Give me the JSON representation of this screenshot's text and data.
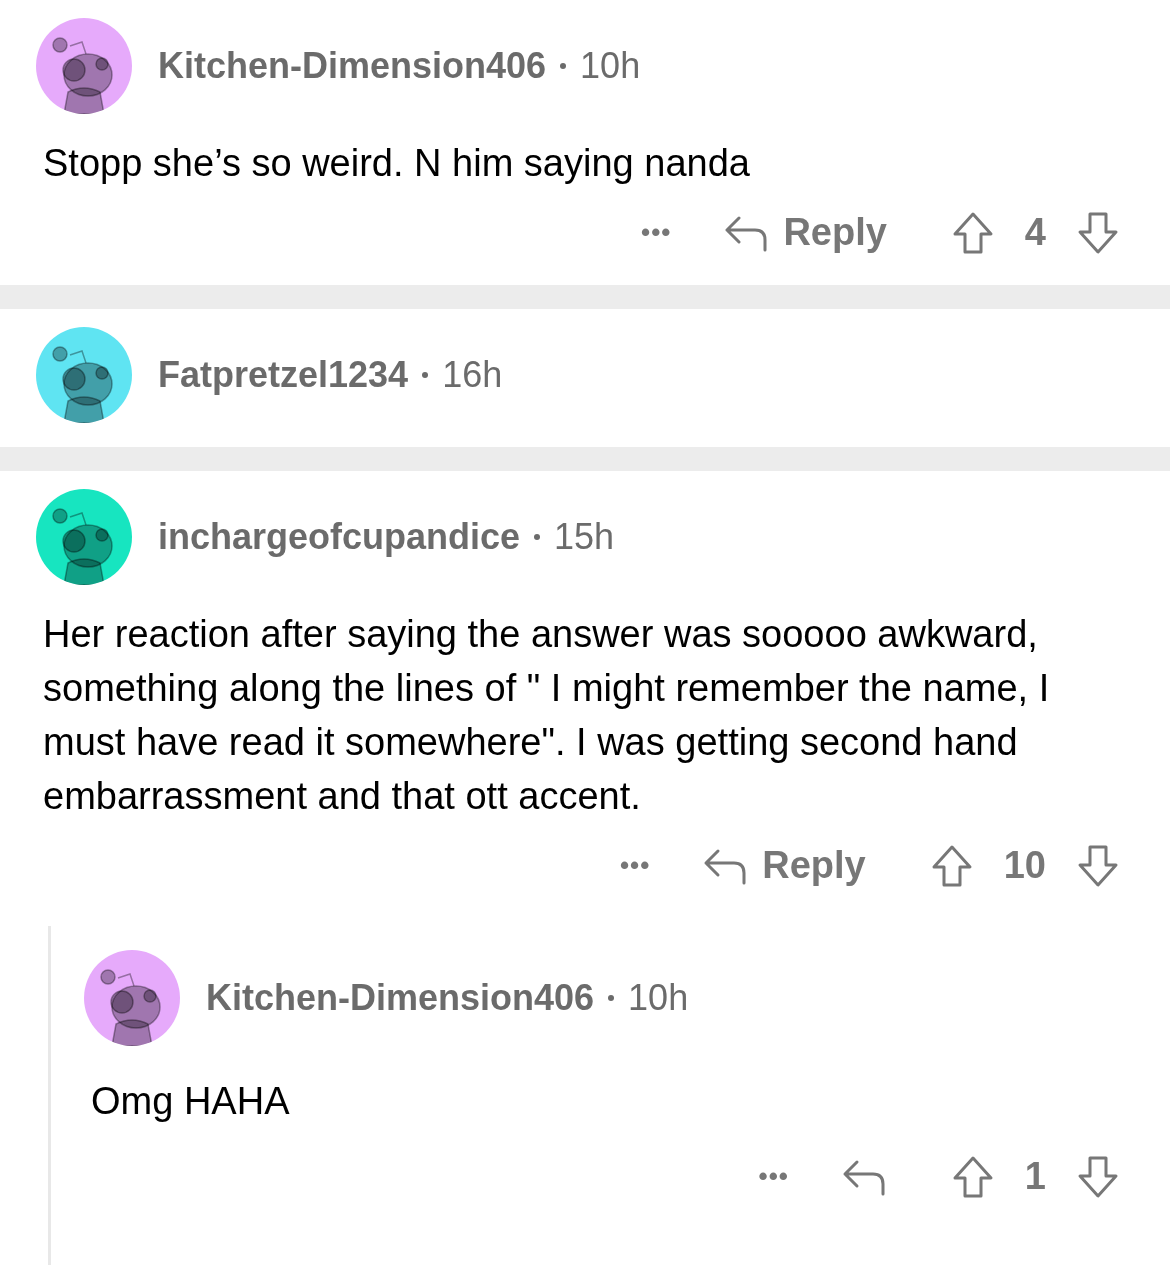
{
  "comments": [
    {
      "author": "Kitchen-Dimension406",
      "time": "10h",
      "color": "#e6aafb",
      "body": "Stopp she’s so weird. N him saying nanda",
      "more": "•••",
      "reply_label": "Reply",
      "score": "4"
    },
    {
      "author": "Fatpretzel1234",
      "time": "16h",
      "color": "#5fe4f2"
    },
    {
      "author": "inchargeofcupandice",
      "time": "15h",
      "color": "#17e5c0",
      "body": "Her reaction after saying the answer was sooooo awkward, something along the lines of \" I might remember the name, I must have read it somewhere\". I was getting second hand embarrassment and that ott accent.",
      "more": "•••",
      "reply_label": "Reply",
      "score": "10",
      "replies": [
        {
          "author": "Kitchen-Dimension406",
          "time": "10h",
          "color": "#e6aafb",
          "body": "Omg HAHA",
          "more": "•••",
          "score": "1"
        }
      ]
    }
  ]
}
